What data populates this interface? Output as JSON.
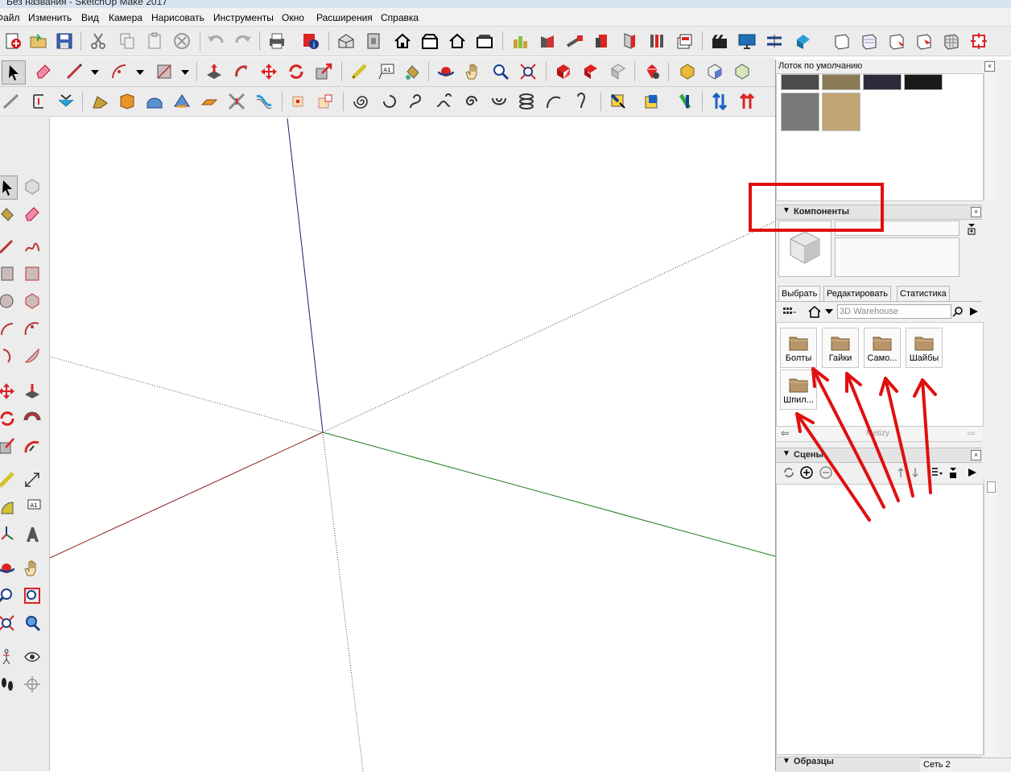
{
  "window": {
    "title": "Без названия - SketchUp Make 2017"
  },
  "menu": {
    "items": [
      "Файл",
      "Изменить",
      "Вид",
      "Камера",
      "Нарисовать",
      "Инструменты",
      "Окно",
      "Расширения",
      "Справка"
    ]
  },
  "tray": {
    "title": "Лоток по умолчанию",
    "materials": {
      "swatch_colors": [
        "#4a4c4c",
        "#8a7a55",
        "#2b2b3a",
        "#1a1a1a",
        "#7b7978",
        "#c2a574"
      ]
    },
    "components": {
      "title": "Компоненты",
      "tabs": [
        "Выбрать",
        "Редактировать",
        "Статистика"
      ],
      "search": {
        "value": "3D Warehouse"
      },
      "folders": [
        "Болты",
        "Гайки",
        "Само...",
        "Шайбы",
        "Шпил..."
      ],
      "collection_name": "Metizy"
    },
    "scenes": {
      "title": "Сцены"
    },
    "bottom_panel": {
      "title": "Образцы"
    }
  },
  "status": {
    "grid_label": "Сеть 2"
  },
  "annotations": {
    "highlight_color": "#e01010"
  },
  "colors": {
    "axis_red": "#8b1a1a",
    "axis_green": "#1f7a1f",
    "axis_blue": "#1a1a6e"
  }
}
